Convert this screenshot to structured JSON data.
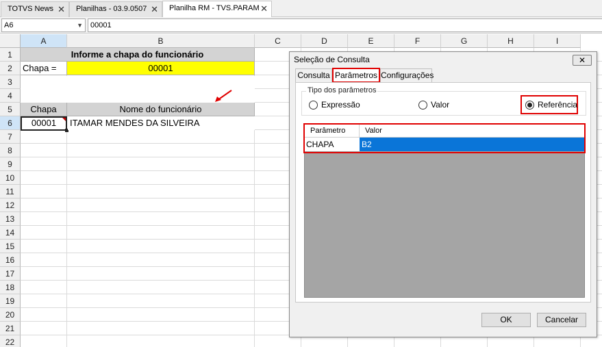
{
  "tabs": [
    {
      "label": "TOTVS News"
    },
    {
      "label": "Planilhas - 03.9.0507"
    },
    {
      "label": "Planilha RM - TVS.PARAM"
    }
  ],
  "formula_bar": {
    "name_box": "A6",
    "value": "00001"
  },
  "columns": [
    "A",
    "B",
    "C",
    "D",
    "E",
    "F",
    "G",
    "H",
    "I"
  ],
  "rows": [
    "1",
    "2",
    "3",
    "4",
    "5",
    "6",
    "7",
    "8",
    "9",
    "10",
    "11",
    "12",
    "13",
    "14",
    "15",
    "16",
    "17",
    "18",
    "19",
    "20",
    "21",
    "22"
  ],
  "cells": {
    "title": "Informe a chapa do funcionário",
    "chapa_label": "Chapa =",
    "chapa_value": "00001",
    "col_chapa": "Chapa",
    "col_nome": "Nome do funcionário",
    "a6": "00001",
    "b6": "ITAMAR MENDES DA SILVEIRA"
  },
  "dialog": {
    "title": "Seleção de Consulta",
    "close": "✕",
    "tabs": [
      "Consulta",
      "Parâmetros",
      "Configurações"
    ],
    "active_tab": "Parâmetros",
    "group_label": "Tipo dos parâmetros",
    "radios": [
      "Expressão",
      "Valor",
      "Referência"
    ],
    "selected_radio": "Referência",
    "table_headers": [
      "Parâmetro",
      "Valor"
    ],
    "table_rows": [
      {
        "param": "CHAPA",
        "valor": "B2"
      }
    ],
    "ok": "OK",
    "cancel": "Cancelar"
  },
  "colors": {
    "highlight_yellow": "#ffff00",
    "annotation_red": "#e00000",
    "selection_blue": "#0a75d8"
  }
}
